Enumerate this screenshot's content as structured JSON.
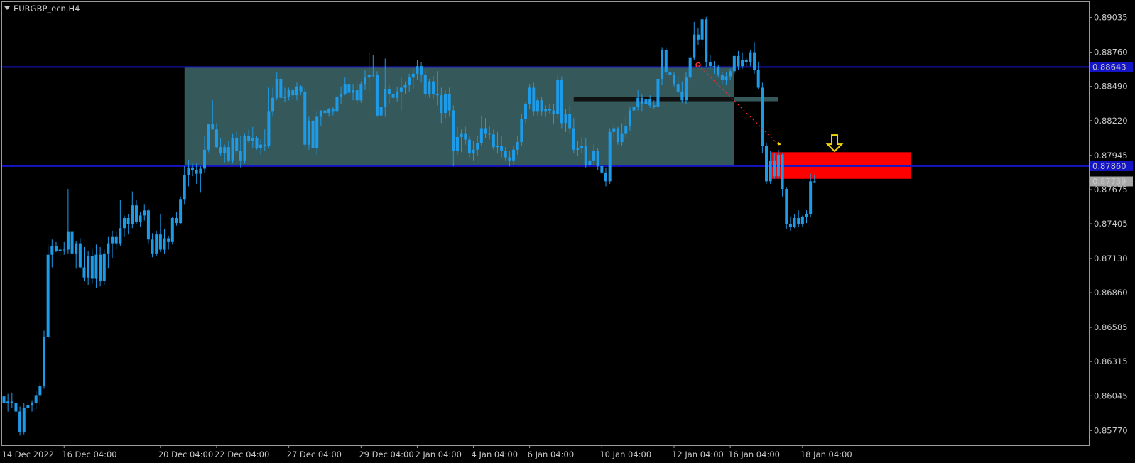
{
  "window": {
    "title": "EURGBP_ecn,H4"
  },
  "colors": {
    "background": "#000000",
    "grid_frame": "#9a9a9a",
    "candle": "#1e9be8",
    "level_line": "#1515c8",
    "zone_fill": "#35585a",
    "red_zone": "#ff0000",
    "arrow": "#f2d40c",
    "price_current_bg": "#a8a8a8"
  },
  "chart_data": {
    "type": "candlestick",
    "symbol": "EURGBP_ecn",
    "timeframe": "H4",
    "ylim": [
      0.85665,
      0.89145
    ],
    "y_ticks": [
      "0.89035",
      "0.88760",
      "0.88490",
      "0.88220",
      "0.87945",
      "0.87675",
      "0.87405",
      "0.87130",
      "0.86860",
      "0.86585",
      "0.86315",
      "0.86045",
      "0.85770"
    ],
    "x_ticks": [
      "14 Dec 2022",
      "16 Dec 04:00",
      "20 Dec 04:00",
      "22 Dec 04:00",
      "27 Dec 04:00",
      "29 Dec 04:00",
      "2 Jan 04:00",
      "4 Jan 04:00",
      "6 Jan 04:00",
      "10 Jan 04:00",
      "12 Jan 04:00",
      "16 Jan 04:00",
      "18 Jan 04:00"
    ],
    "x_tick_index": [
      0,
      15,
      39,
      53,
      71,
      89,
      103,
      117,
      131,
      149,
      167,
      181,
      199
    ],
    "horizontal_levels": [
      {
        "price": 0.88643,
        "label": "0.88643"
      },
      {
        "price": 0.8786,
        "label": "0.87860"
      }
    ],
    "current_price": {
      "price": 0.87739,
      "label": "0.87739"
    },
    "ohlc": [
      [
        0.8604,
        0.8608,
        0.859,
        0.8599
      ],
      [
        0.8599,
        0.8606,
        0.8592,
        0.86
      ],
      [
        0.86,
        0.8607,
        0.8595,
        0.8599
      ],
      [
        0.8599,
        0.8602,
        0.8588,
        0.8592
      ],
      [
        0.8592,
        0.8596,
        0.8573,
        0.8576
      ],
      [
        0.8576,
        0.8599,
        0.8574,
        0.8595
      ],
      [
        0.8595,
        0.86,
        0.8591,
        0.8597
      ],
      [
        0.8597,
        0.8601,
        0.8592,
        0.8599
      ],
      [
        0.8599,
        0.8608,
        0.8594,
        0.8605
      ],
      [
        0.8605,
        0.8615,
        0.8597,
        0.8612
      ],
      [
        0.8612,
        0.8656,
        0.861,
        0.8651
      ],
      [
        0.8651,
        0.8724,
        0.8649,
        0.8716
      ],
      [
        0.8716,
        0.8728,
        0.8706,
        0.8723
      ],
      [
        0.8723,
        0.8726,
        0.8718,
        0.8719
      ],
      [
        0.8719,
        0.8723,
        0.8715,
        0.872
      ],
      [
        0.872,
        0.8726,
        0.8716,
        0.872
      ],
      [
        0.872,
        0.8768,
        0.8717,
        0.8734
      ],
      [
        0.8734,
        0.8735,
        0.8716,
        0.8717
      ],
      [
        0.8717,
        0.8727,
        0.8705,
        0.8725
      ],
      [
        0.8725,
        0.8729,
        0.8705,
        0.8706
      ],
      [
        0.8706,
        0.8722,
        0.8695,
        0.8698
      ],
      [
        0.8698,
        0.8719,
        0.8692,
        0.8715
      ],
      [
        0.8715,
        0.872,
        0.8693,
        0.8697
      ],
      [
        0.8697,
        0.8724,
        0.869,
        0.8716
      ],
      [
        0.8716,
        0.8722,
        0.8691,
        0.8695
      ],
      [
        0.8695,
        0.872,
        0.8692,
        0.8717
      ],
      [
        0.8717,
        0.873,
        0.8705,
        0.8725
      ],
      [
        0.8725,
        0.8735,
        0.8713,
        0.873
      ],
      [
        0.873,
        0.8734,
        0.872,
        0.8725
      ],
      [
        0.8725,
        0.8759,
        0.8723,
        0.8737
      ],
      [
        0.8737,
        0.8747,
        0.873,
        0.8745
      ],
      [
        0.8745,
        0.8748,
        0.8732,
        0.874
      ],
      [
        0.874,
        0.8766,
        0.8737,
        0.8755
      ],
      [
        0.8755,
        0.8759,
        0.874,
        0.8742
      ],
      [
        0.8742,
        0.875,
        0.8738,
        0.8747
      ],
      [
        0.8747,
        0.8756,
        0.8743,
        0.8751
      ],
      [
        0.8751,
        0.8752,
        0.8725,
        0.8728
      ],
      [
        0.8728,
        0.8733,
        0.8714,
        0.8717
      ],
      [
        0.8717,
        0.8735,
        0.8715,
        0.8732
      ],
      [
        0.8732,
        0.8748,
        0.8718,
        0.872
      ],
      [
        0.872,
        0.8736,
        0.8717,
        0.8729
      ],
      [
        0.8729,
        0.8731,
        0.872,
        0.8726
      ],
      [
        0.8726,
        0.8746,
        0.8724,
        0.8745
      ],
      [
        0.8745,
        0.875,
        0.8739,
        0.8741
      ],
      [
        0.8741,
        0.8762,
        0.874,
        0.876
      ],
      [
        0.876,
        0.8786,
        0.8756,
        0.8779
      ],
      [
        0.8779,
        0.8791,
        0.877,
        0.8785
      ],
      [
        0.8785,
        0.8788,
        0.8778,
        0.8783
      ],
      [
        0.8783,
        0.8788,
        0.8772,
        0.878
      ],
      [
        0.878,
        0.8786,
        0.8765,
        0.8784
      ],
      [
        0.8784,
        0.881,
        0.8781,
        0.8799
      ],
      [
        0.8799,
        0.8819,
        0.8797,
        0.8819
      ],
      [
        0.8819,
        0.8838,
        0.8815,
        0.8815
      ],
      [
        0.8815,
        0.882,
        0.88,
        0.8801
      ],
      [
        0.8801,
        0.8808,
        0.8794,
        0.8796
      ],
      [
        0.8796,
        0.8803,
        0.8789,
        0.8801
      ],
      [
        0.8801,
        0.8806,
        0.8789,
        0.879
      ],
      [
        0.879,
        0.8812,
        0.8788,
        0.8808
      ],
      [
        0.8808,
        0.8814,
        0.8796,
        0.8798
      ],
      [
        0.8798,
        0.881,
        0.8785,
        0.879
      ],
      [
        0.879,
        0.8812,
        0.8788,
        0.881
      ],
      [
        0.881,
        0.8815,
        0.8804,
        0.8806
      ],
      [
        0.8806,
        0.8817,
        0.88,
        0.8808
      ],
      [
        0.8808,
        0.881,
        0.8799,
        0.88
      ],
      [
        0.88,
        0.8807,
        0.8795,
        0.8803
      ],
      [
        0.8803,
        0.8815,
        0.8798,
        0.8802
      ],
      [
        0.8802,
        0.8848,
        0.88,
        0.8829
      ],
      [
        0.8829,
        0.8848,
        0.8825,
        0.884
      ],
      [
        0.884,
        0.886,
        0.8838,
        0.8855
      ],
      [
        0.8855,
        0.8856,
        0.8839,
        0.884
      ],
      [
        0.884,
        0.8848,
        0.8837,
        0.8841
      ],
      [
        0.8841,
        0.8848,
        0.8838,
        0.8846
      ],
      [
        0.8846,
        0.8848,
        0.8839,
        0.8842
      ],
      [
        0.8842,
        0.8852,
        0.8838,
        0.8849
      ],
      [
        0.8849,
        0.885,
        0.8842,
        0.8845
      ],
      [
        0.8845,
        0.8848,
        0.8801,
        0.8803
      ],
      [
        0.8803,
        0.8825,
        0.8799,
        0.8822
      ],
      [
        0.8822,
        0.8831,
        0.8797,
        0.88
      ],
      [
        0.88,
        0.8829,
        0.8795,
        0.8825
      ],
      [
        0.8825,
        0.883,
        0.8818,
        0.883
      ],
      [
        0.883,
        0.8833,
        0.8824,
        0.8828
      ],
      [
        0.8828,
        0.8832,
        0.8825,
        0.8831
      ],
      [
        0.8831,
        0.8833,
        0.8826,
        0.8829
      ],
      [
        0.8829,
        0.8842,
        0.8824,
        0.8841
      ],
      [
        0.8841,
        0.8849,
        0.8835,
        0.8843
      ],
      [
        0.8843,
        0.8856,
        0.8842,
        0.8851
      ],
      [
        0.8851,
        0.8855,
        0.8842,
        0.8844
      ],
      [
        0.8844,
        0.8851,
        0.8838,
        0.8846
      ],
      [
        0.8846,
        0.8852,
        0.8835,
        0.8838
      ],
      [
        0.8838,
        0.8853,
        0.8836,
        0.8851
      ],
      [
        0.8851,
        0.8862,
        0.8846,
        0.8856
      ],
      [
        0.8856,
        0.8876,
        0.8844,
        0.8858
      ],
      [
        0.8858,
        0.8874,
        0.8856,
        0.8858
      ],
      [
        0.8858,
        0.8861,
        0.8825,
        0.8826
      ],
      [
        0.8826,
        0.8834,
        0.884,
        0.8833
      ],
      [
        0.8833,
        0.8871,
        0.8825,
        0.8847
      ],
      [
        0.8847,
        0.885,
        0.8835,
        0.8843
      ],
      [
        0.8843,
        0.8847,
        0.8837,
        0.884
      ],
      [
        0.884,
        0.8849,
        0.8837,
        0.8845
      ],
      [
        0.8845,
        0.8856,
        0.883,
        0.8848
      ],
      [
        0.8848,
        0.8853,
        0.8843,
        0.885
      ],
      [
        0.885,
        0.8859,
        0.8845,
        0.8856
      ],
      [
        0.8856,
        0.8863,
        0.8847,
        0.8859
      ],
      [
        0.8859,
        0.887,
        0.8854,
        0.8865
      ],
      [
        0.8865,
        0.8868,
        0.8852,
        0.8858
      ],
      [
        0.8858,
        0.8862,
        0.884,
        0.8843
      ],
      [
        0.8843,
        0.8855,
        0.884,
        0.8853
      ],
      [
        0.8853,
        0.8857,
        0.8839,
        0.8843
      ],
      [
        0.8843,
        0.8861,
        0.8834,
        0.8842
      ],
      [
        0.8842,
        0.8848,
        0.882,
        0.8828
      ],
      [
        0.8828,
        0.8846,
        0.8824,
        0.8843
      ],
      [
        0.8843,
        0.8848,
        0.8825,
        0.883
      ],
      [
        0.883,
        0.8834,
        0.8786,
        0.8798
      ],
      [
        0.8798,
        0.8817,
        0.8795,
        0.8809
      ],
      [
        0.8809,
        0.8815,
        0.8797,
        0.8812
      ],
      [
        0.8812,
        0.8817,
        0.8803,
        0.8807
      ],
      [
        0.8807,
        0.881,
        0.8793,
        0.8796
      ],
      [
        0.8796,
        0.8806,
        0.879,
        0.8799
      ],
      [
        0.8799,
        0.881,
        0.8794,
        0.8804
      ],
      [
        0.8804,
        0.8826,
        0.8802,
        0.8816
      ],
      [
        0.8816,
        0.8824,
        0.8808,
        0.8812
      ],
      [
        0.8812,
        0.8818,
        0.8807,
        0.8811
      ],
      [
        0.8811,
        0.8815,
        0.8799,
        0.8801
      ],
      [
        0.8801,
        0.8813,
        0.8796,
        0.8802
      ],
      [
        0.8802,
        0.881,
        0.8793,
        0.8798
      ],
      [
        0.8798,
        0.8801,
        0.879,
        0.8793
      ],
      [
        0.8793,
        0.8798,
        0.8786,
        0.879
      ],
      [
        0.879,
        0.8802,
        0.8787,
        0.8799
      ],
      [
        0.8799,
        0.881,
        0.8795,
        0.8805
      ],
      [
        0.8805,
        0.8827,
        0.8802,
        0.8823
      ],
      [
        0.8823,
        0.8837,
        0.882,
        0.8835
      ],
      [
        0.8835,
        0.8851,
        0.8831,
        0.8848
      ],
      [
        0.8848,
        0.8852,
        0.8826,
        0.8829
      ],
      [
        0.8829,
        0.884,
        0.8826,
        0.8838
      ],
      [
        0.8838,
        0.8841,
        0.8826,
        0.8829
      ],
      [
        0.8829,
        0.8834,
        0.8825,
        0.8831
      ],
      [
        0.8831,
        0.8835,
        0.8827,
        0.883
      ],
      [
        0.883,
        0.8835,
        0.8819,
        0.8827
      ],
      [
        0.8827,
        0.8858,
        0.8824,
        0.8854
      ],
      [
        0.8854,
        0.8857,
        0.8816,
        0.882
      ],
      [
        0.882,
        0.8831,
        0.8813,
        0.8827
      ],
      [
        0.8827,
        0.8834,
        0.8812,
        0.8816
      ],
      [
        0.8816,
        0.8824,
        0.8796,
        0.8799
      ],
      [
        0.8799,
        0.8806,
        0.8794,
        0.88
      ],
      [
        0.88,
        0.8808,
        0.8796,
        0.8802
      ],
      [
        0.8802,
        0.8808,
        0.8785,
        0.8787
      ],
      [
        0.8787,
        0.8796,
        0.8785,
        0.879
      ],
      [
        0.879,
        0.8803,
        0.8787,
        0.8798
      ],
      [
        0.8798,
        0.88,
        0.8783,
        0.8786
      ],
      [
        0.8786,
        0.8788,
        0.8779,
        0.8781
      ],
      [
        0.8781,
        0.8785,
        0.877,
        0.8774
      ],
      [
        0.8774,
        0.8816,
        0.8772,
        0.8813
      ],
      [
        0.8813,
        0.8819,
        0.8808,
        0.8816
      ],
      [
        0.8816,
        0.8817,
        0.8803,
        0.8805
      ],
      [
        0.8805,
        0.882,
        0.8802,
        0.8812
      ],
      [
        0.8812,
        0.8825,
        0.8808,
        0.8818
      ],
      [
        0.8818,
        0.8833,
        0.8814,
        0.883
      ],
      [
        0.883,
        0.8838,
        0.8822,
        0.8833
      ],
      [
        0.8833,
        0.8846,
        0.883,
        0.884
      ],
      [
        0.884,
        0.8843,
        0.8829,
        0.8835
      ],
      [
        0.8835,
        0.8844,
        0.8831,
        0.8839
      ],
      [
        0.8839,
        0.8842,
        0.8832,
        0.8834
      ],
      [
        0.8834,
        0.8838,
        0.8831,
        0.8833
      ],
      [
        0.8833,
        0.8857,
        0.8829,
        0.8855
      ],
      [
        0.8855,
        0.888,
        0.885,
        0.8878
      ],
      [
        0.8878,
        0.888,
        0.8858,
        0.886
      ],
      [
        0.886,
        0.8862,
        0.8855,
        0.8858
      ],
      [
        0.8858,
        0.886,
        0.8849,
        0.8851
      ],
      [
        0.8851,
        0.8856,
        0.8843,
        0.8845
      ],
      [
        0.8845,
        0.8853,
        0.8836,
        0.8838
      ],
      [
        0.8838,
        0.886,
        0.8835,
        0.8856
      ],
      [
        0.8856,
        0.8874,
        0.8853,
        0.8872
      ],
      [
        0.8872,
        0.89,
        0.887,
        0.889
      ],
      [
        0.889,
        0.8895,
        0.8882,
        0.8886
      ],
      [
        0.8886,
        0.8904,
        0.888,
        0.8902
      ],
      [
        0.8902,
        0.8904,
        0.8864,
        0.8868
      ],
      [
        0.8868,
        0.8874,
        0.8863,
        0.8865
      ],
      [
        0.8865,
        0.8869,
        0.8859,
        0.8864
      ],
      [
        0.8864,
        0.8866,
        0.8856,
        0.8858
      ],
      [
        0.8858,
        0.886,
        0.8851,
        0.8854
      ],
      [
        0.8854,
        0.886,
        0.885,
        0.8857
      ],
      [
        0.8857,
        0.8863,
        0.8854,
        0.8861
      ],
      [
        0.8861,
        0.8874,
        0.8859,
        0.8873
      ],
      [
        0.8873,
        0.8877,
        0.8862,
        0.8865
      ],
      [
        0.8865,
        0.8876,
        0.8863,
        0.887
      ],
      [
        0.887,
        0.8872,
        0.8864,
        0.8868
      ],
      [
        0.8868,
        0.8878,
        0.8865,
        0.8876
      ],
      [
        0.8876,
        0.8884,
        0.8859,
        0.8862
      ],
      [
        0.8862,
        0.8868,
        0.8847,
        0.8848
      ],
      [
        0.8848,
        0.8852,
        0.8796,
        0.8802
      ],
      [
        0.8802,
        0.8804,
        0.8772,
        0.8774
      ],
      [
        0.8774,
        0.8798,
        0.8772,
        0.879
      ],
      [
        0.879,
        0.8796,
        0.8776,
        0.8778
      ],
      [
        0.8778,
        0.8799,
        0.8776,
        0.8795
      ],
      [
        0.8795,
        0.8796,
        0.8762,
        0.8768
      ],
      [
        0.8768,
        0.8769,
        0.8736,
        0.874
      ],
      [
        0.874,
        0.8746,
        0.8735,
        0.8738
      ],
      [
        0.8738,
        0.8748,
        0.8737,
        0.8745
      ],
      [
        0.8745,
        0.8751,
        0.8738,
        0.874
      ],
      [
        0.874,
        0.8747,
        0.8738,
        0.8746
      ],
      [
        0.8746,
        0.8751,
        0.8741,
        0.8748
      ],
      [
        0.8748,
        0.878,
        0.8746,
        0.8774
      ],
      [
        0.8774,
        0.8779,
        0.8773,
        0.87739
      ]
    ],
    "zones": [
      {
        "kind": "range-box",
        "from_index": 45,
        "to_index": 182,
        "price_top": 0.88643,
        "price_bottom": 0.8786
      },
      {
        "kind": "black-line",
        "from_index": 142,
        "to_index": 182,
        "price": 0.8839
      },
      {
        "kind": "grey-line",
        "from_index": 182,
        "to_index": 193,
        "price": 0.8839
      },
      {
        "kind": "red-zone",
        "from_index": 191,
        "to_index": 226,
        "price_top": 0.8797,
        "price_bottom": 0.8776
      }
    ],
    "annotations": [
      {
        "kind": "down-arrow",
        "index": 207,
        "price": 0.8796
      },
      {
        "kind": "dashed-trend",
        "from_index": 173,
        "from_price": 0.8866,
        "to_index": 193,
        "to_price": 0.8803
      }
    ]
  }
}
